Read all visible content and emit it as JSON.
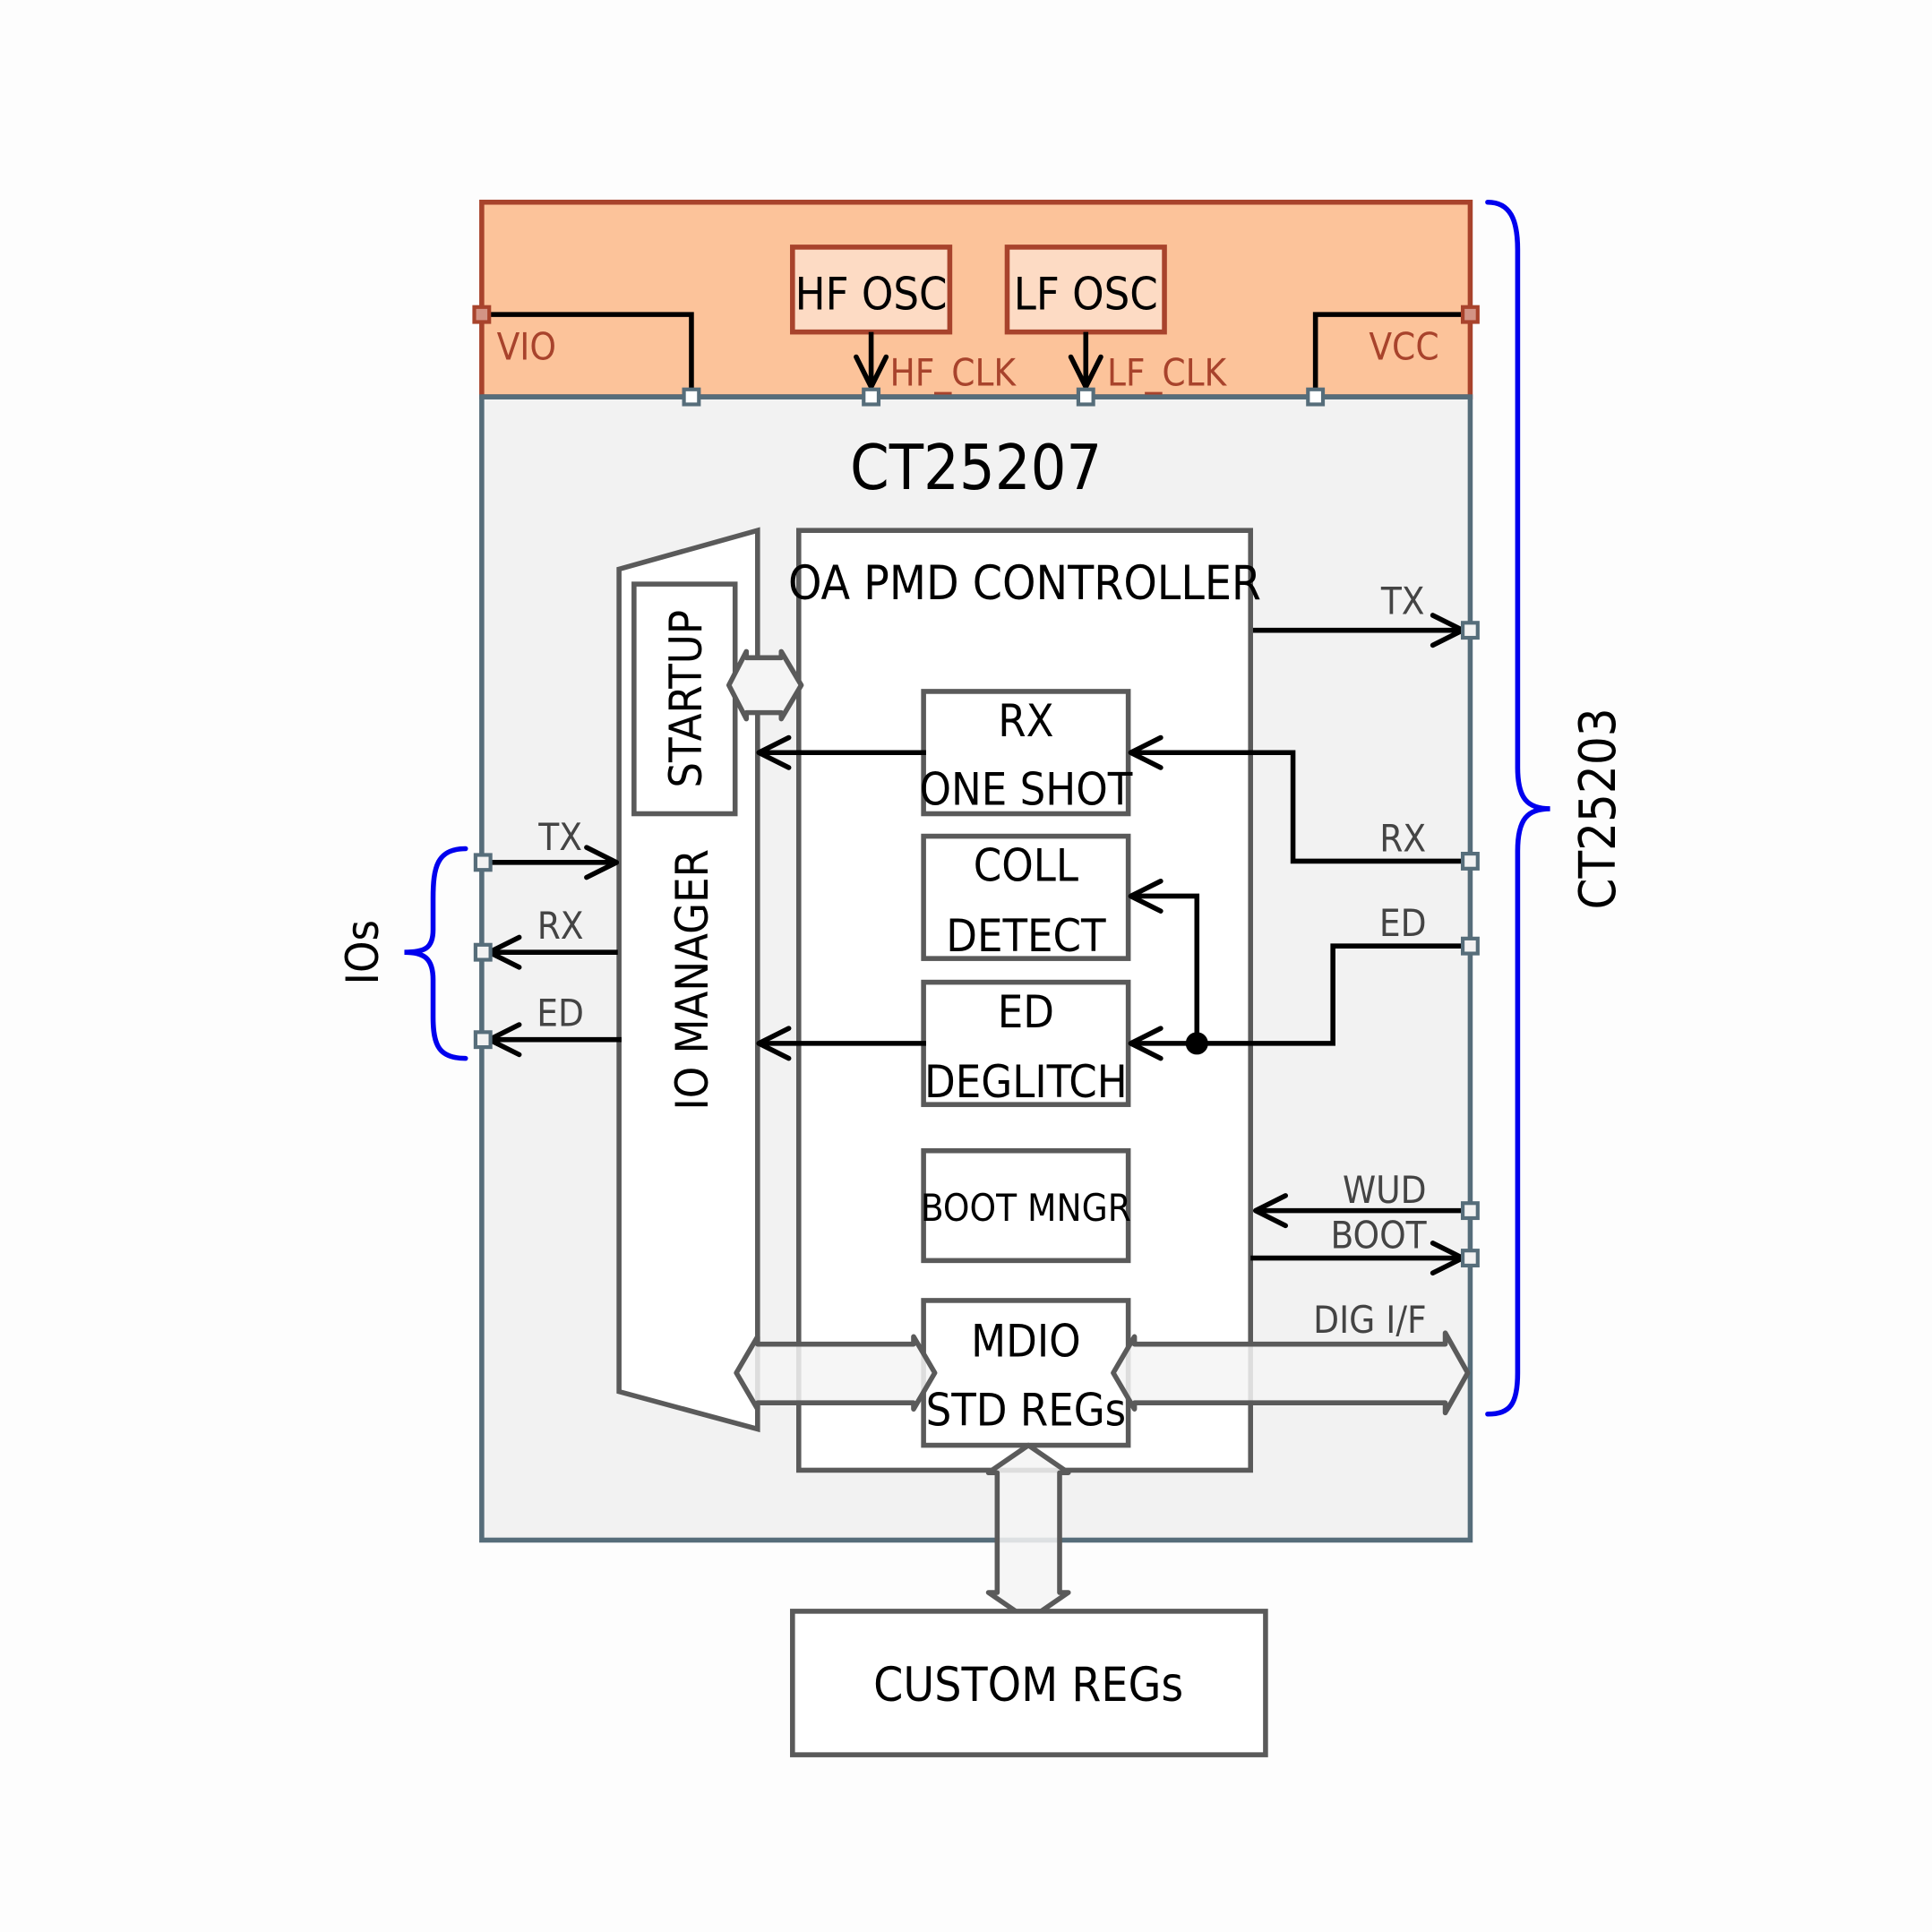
{
  "diagram": {
    "outer_label": "CT25203",
    "chip_label": "CT25207",
    "power_domain": {
      "oscillators": [
        "HF OSC",
        "LF OSC"
      ],
      "clocks": [
        "HF_CLK",
        "LF_CLK"
      ],
      "supplies": [
        "VIO",
        "VCC"
      ]
    },
    "io_manager": {
      "label": "IO MANAGER",
      "startup_label": "STARTUP"
    },
    "controller": {
      "title": "OA PMD CONTROLLER",
      "blocks": [
        {
          "line1": "RX",
          "line2": "ONE SHOT"
        },
        {
          "line1": "COLL",
          "line2": "DETECT"
        },
        {
          "line1": "ED",
          "line2": "DEGLITCH"
        },
        {
          "line1": "BOOT MNGR",
          "line2": ""
        },
        {
          "line1": "MDIO",
          "line2": "STD REGs"
        }
      ]
    },
    "custom_regs_label": "CUSTOM REGs",
    "left_ios": {
      "group_label": "IOs",
      "signals": [
        "TX",
        "RX",
        "ED"
      ]
    },
    "right_signals": [
      "TX",
      "RX",
      "ED",
      "WUD",
      "BOOT",
      "DIG I/F"
    ],
    "colors": {
      "power_fill": "#fcc39a",
      "power_border": "#a8432c",
      "osc_fill": "#fddbc4",
      "chip_fill": "#f2f2f2",
      "chip_border": "#566d7a",
      "block_border": "#5a5a5a",
      "brace": "#0000ee"
    }
  }
}
